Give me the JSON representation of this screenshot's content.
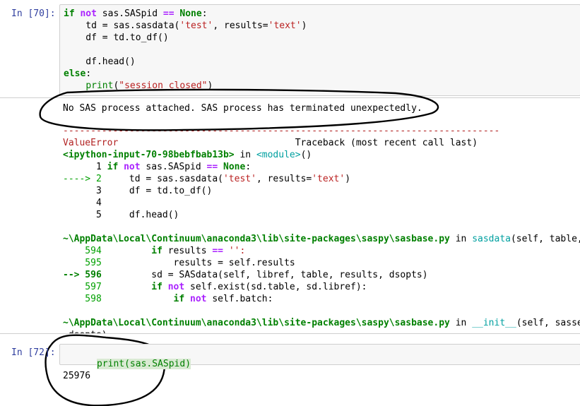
{
  "cell70": {
    "prompt": "In [70]:",
    "code": [
      [
        [
          "if",
          "kw"
        ],
        [
          " ",
          ""
        ],
        [
          "not",
          "op"
        ],
        [
          " sas.SASpid ",
          ""
        ],
        [
          "==",
          "op"
        ],
        [
          " ",
          ""
        ],
        [
          "None",
          "none"
        ],
        [
          ":",
          ""
        ]
      ],
      [
        [
          "    td = sas.sasdata(",
          ""
        ],
        [
          "'test'",
          "str"
        ],
        [
          ", results=",
          ""
        ],
        [
          "'text'",
          "str"
        ],
        [
          ")",
          ""
        ]
      ],
      [
        [
          "    df = td.to_df()",
          ""
        ]
      ],
      [
        [
          "",
          ""
        ]
      ],
      [
        [
          "    df.head()",
          ""
        ]
      ],
      [
        [
          "else",
          "kw"
        ],
        [
          ":",
          ""
        ]
      ],
      [
        [
          "    ",
          ""
        ],
        [
          "print",
          "fn"
        ],
        [
          "(",
          ""
        ],
        [
          "\"session closed\"",
          "str"
        ],
        [
          ")",
          ""
        ]
      ]
    ],
    "stderr": "No SAS process attached. SAS process has terminated unexpectedly.",
    "traceback": [
      [
        [
          "-------------------------------------------------------------------------------",
          "err-red"
        ]
      ],
      [
        [
          "ValueError",
          "err-red"
        ],
        [
          "                                Traceback (most recent call last)",
          ""
        ]
      ],
      [
        [
          "<ipython-input-70-98bebfbab13b>",
          "green-b"
        ],
        [
          " in ",
          ""
        ],
        [
          "<module>",
          "cyan"
        ],
        [
          "()",
          ""
        ]
      ],
      [
        [
          "      1 ",
          ""
        ],
        [
          "if",
          "kw"
        ],
        [
          " ",
          ""
        ],
        [
          "not",
          "op"
        ],
        [
          " sas.SASpid ",
          ""
        ],
        [
          "==",
          "op"
        ],
        [
          " ",
          ""
        ],
        [
          "None",
          "none"
        ],
        [
          ":",
          ""
        ]
      ],
      [
        [
          "----> 2",
          "green"
        ],
        [
          "     td = sas.sasdata(",
          ""
        ],
        [
          "'test'",
          "str"
        ],
        [
          ", results=",
          ""
        ],
        [
          "'text'",
          "str"
        ],
        [
          ")",
          ""
        ]
      ],
      [
        [
          "      3     df = td.to_df()",
          ""
        ]
      ],
      [
        [
          "      4",
          ""
        ]
      ],
      [
        [
          "      5     df.head()",
          ""
        ]
      ],
      [
        [
          "",
          ""
        ]
      ],
      [
        [
          "~\\AppData\\Local\\Continuum\\anaconda3\\lib\\site-packages\\saspy\\sasbase.py",
          "green-b"
        ],
        [
          " in ",
          ""
        ],
        [
          "sasdata",
          "cyan"
        ],
        [
          "(self, table,",
          ""
        ]
      ],
      [
        [
          "    594",
          "green"
        ],
        [
          "         ",
          ""
        ],
        [
          "if",
          "kw"
        ],
        [
          " results ",
          ""
        ],
        [
          "==",
          "op"
        ],
        [
          " ",
          ""
        ],
        [
          "'':",
          "str"
        ]
      ],
      [
        [
          "    595",
          "green"
        ],
        [
          "             results = self.results",
          ""
        ]
      ],
      [
        [
          "--> 596",
          "green-b"
        ],
        [
          "         sd = SASdata(self, libref, table, results, dsopts)",
          ""
        ]
      ],
      [
        [
          "    597",
          "green"
        ],
        [
          "         ",
          ""
        ],
        [
          "if",
          "kw"
        ],
        [
          " ",
          ""
        ],
        [
          "not",
          "op"
        ],
        [
          " self.exist(sd.table, sd.libref):",
          ""
        ]
      ],
      [
        [
          "    598",
          "green"
        ],
        [
          "             ",
          ""
        ],
        [
          "if",
          "kw"
        ],
        [
          " ",
          ""
        ],
        [
          "not",
          "op"
        ],
        [
          " self.batch:",
          ""
        ]
      ],
      [
        [
          "",
          ""
        ]
      ],
      [
        [
          "~\\AppData\\Local\\Continuum\\anaconda3\\lib\\site-packages\\saspy\\sasbase.py",
          "green-b"
        ],
        [
          " in ",
          ""
        ],
        [
          "__init__",
          "cyan"
        ],
        [
          "(self, sasses",
          ""
        ]
      ],
      [
        [
          " dsopts)",
          ""
        ]
      ]
    ]
  },
  "cell72": {
    "prompt": "In [72]:",
    "code": "print(sas.SASpid)",
    "output": "25976"
  }
}
